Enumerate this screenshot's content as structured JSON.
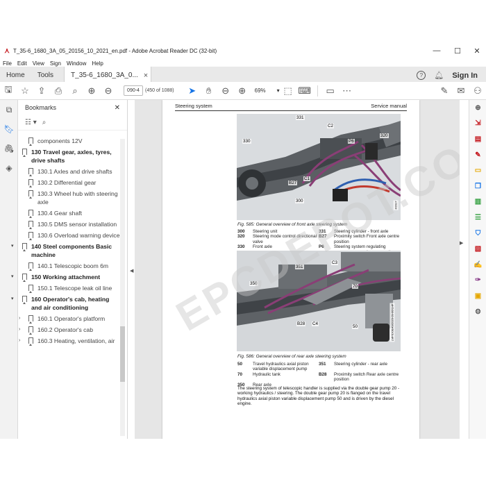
{
  "window": {
    "title": "T_35-6_1680_3A_05_20156_10_2021_en.pdf - Adobe Acrobat Reader DC (32-bit)",
    "minimize": "—",
    "maximize": "☐",
    "close": "✕"
  },
  "menu": [
    "File",
    "Edit",
    "View",
    "Sign",
    "Window",
    "Help"
  ],
  "tabs": {
    "home": "Home",
    "tools": "Tools",
    "document": "T_35-6_1680_3A_0...",
    "close": "×",
    "help_icon": "?",
    "sign_in": "Sign In"
  },
  "toolbar": {
    "page_number": "090-4",
    "page_count": "(450 of 1088)",
    "zoom": "69%",
    "zoom_caret": "▾"
  },
  "bookmarks": {
    "title": "Bookmarks",
    "close": "✕",
    "items": [
      {
        "label": "components 12V",
        "level": 2,
        "caret": ""
      },
      {
        "label": "130 Travel gear, axles, tyres, drive shafts",
        "level": 1,
        "caret": "▾"
      },
      {
        "label": "130.1 Axles and drive shafts",
        "level": 2,
        "caret": ""
      },
      {
        "label": "130.2 Differential gear",
        "level": 2,
        "caret": ""
      },
      {
        "label": "130.3 Wheel hub with steering axle",
        "level": 2,
        "caret": ""
      },
      {
        "label": "130.4 Gear shaft",
        "level": 2,
        "caret": ""
      },
      {
        "label": "130.5 DMS sensor installation",
        "level": 2,
        "caret": ""
      },
      {
        "label": "130.6 Overload warning device",
        "level": 2,
        "caret": ""
      },
      {
        "label": "140 Steel components Basic machine",
        "level": 1,
        "caret": "▾"
      },
      {
        "label": "140.1 Telescopic boom 6m",
        "level": 2,
        "caret": ""
      },
      {
        "label": "150 Working attachment",
        "level": 1,
        "caret": "▾"
      },
      {
        "label": "150.1 Telescope leak oil line",
        "level": 2,
        "caret": ""
      },
      {
        "label": "160 Operator's cab, heating and air conditioning",
        "level": 1,
        "caret": "▾"
      },
      {
        "label": "160.1 Operator's platform",
        "level": 2,
        "caret": "›"
      },
      {
        "label": "160.2 Operator's cab",
        "level": 2,
        "caret": "›"
      },
      {
        "label": "160.3 Heating, ventilation, air",
        "level": 2,
        "caret": "›"
      }
    ]
  },
  "page": {
    "header_left": "Steering system",
    "header_right": "Service manual",
    "fig1": {
      "tags": [
        "331",
        "C2",
        "330",
        "P6",
        "320",
        "C1",
        "B27",
        "300"
      ],
      "side_code": "4/2017",
      "caption": "Fig. 585: General overview of front axle steering system",
      "legend": [
        [
          "300",
          "Steering unit",
          "331",
          "Steering cylinder - front axle"
        ],
        [
          "320",
          "Steering mode control directional valve",
          "B27",
          "Proximity switch Front axle centre position"
        ],
        [
          "330",
          "Front axle",
          "P6",
          "Steering system regulating pressure measuring connection"
        ]
      ]
    },
    "fig2": {
      "tags": [
        "351",
        "C3",
        "350",
        "70",
        "B28",
        "C4",
        "50"
      ],
      "side_code": "LMP/DOBAS/2020-09-06/LHP",
      "caption": "Fig. 586: General overview of rear axle steering system",
      "legend": [
        [
          "50",
          "Travel hydraulics axial piston variable displacement pump",
          "351",
          "Steering cylinder - rear axle"
        ],
        [
          "70",
          "Hydraulic tank",
          "B28",
          "Proximity switch Rear axle centre position"
        ],
        [
          "350",
          "Rear axle",
          "",
          ""
        ]
      ]
    },
    "body": "The steering system of telescopic handler is supplied via the double gear pump 20 - working hydraulics / steering. The double gear pump 20 is flanged on the travel hydraulics axial piston variable displacement pump 50 and is driven by the diesel engine.",
    "watermark": "EPCDEPOT.COM"
  },
  "colors": {
    "accent": "#1473e6",
    "adobe_red": "#c4161c",
    "hose_purple": "#8a3e76",
    "hose_blue": "#2f5fb0",
    "hose_red": "#c23a2e"
  },
  "right_tools": [
    {
      "icon": "zoom-in-icon",
      "color": "#555"
    },
    {
      "icon": "export-pdf-icon",
      "color": "#c4161c"
    },
    {
      "icon": "create-pdf-icon",
      "color": "#c4161c"
    },
    {
      "icon": "edit-pdf-icon",
      "color": "#c4161c"
    },
    {
      "icon": "comment-icon",
      "color": "#e5a700"
    },
    {
      "icon": "combine-files-icon",
      "color": "#1473e6"
    },
    {
      "icon": "organize-pages-icon",
      "color": "#2d9d3a"
    },
    {
      "icon": "redact-icon",
      "color": "#2d9d3a"
    },
    {
      "icon": "protect-icon",
      "color": "#1473e6"
    },
    {
      "icon": "optimize-pdf-icon",
      "color": "#c4161c"
    },
    {
      "icon": "fill-sign-icon",
      "color": "#8a3e8a"
    },
    {
      "icon": "send-sign-icon",
      "color": "#8a3e8a"
    },
    {
      "icon": "rich-media-icon",
      "color": "#e5a700"
    },
    {
      "icon": "more-tools-icon",
      "color": "#555"
    }
  ]
}
